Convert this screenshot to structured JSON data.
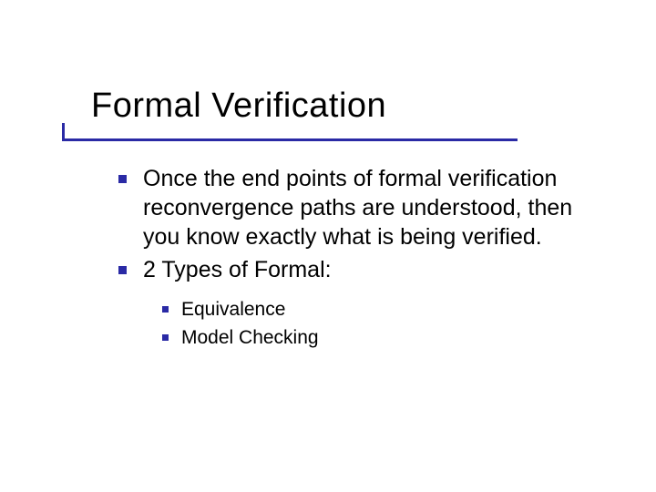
{
  "title": "Formal Verification",
  "bullets": [
    {
      "text": "Once the end points of formal verification reconvergence paths are understood, then you know exactly what is being verified."
    },
    {
      "text": "2 Types of Formal:"
    }
  ],
  "subbullets": [
    {
      "text": "Equivalence"
    },
    {
      "text": "Model Checking"
    }
  ],
  "colors": {
    "accent": "#2a2aa5"
  }
}
